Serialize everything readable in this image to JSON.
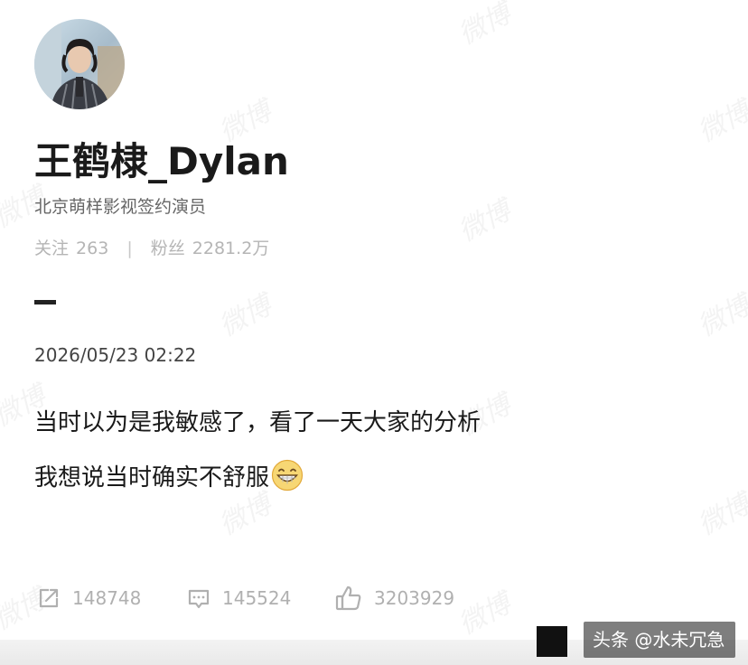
{
  "profile": {
    "name": "王鹤棣_Dylan",
    "verification": "北京萌样影视签约演员",
    "following_label": "关注",
    "following_count": "263",
    "separator": "|",
    "followers_label": "粉丝",
    "followers_count": "2281.2万",
    "avatar_icon": "avatar-photo"
  },
  "post": {
    "dash": "—",
    "timestamp": "2026/05/23 02:22",
    "line1": "当时以为是我敏感了，看了一天大家的分析",
    "line2": "我想说当时确实不舒服",
    "emoji": "grinning-face-emoji"
  },
  "actions": {
    "repost_icon": "share-icon",
    "repost_count": "148748",
    "comment_icon": "comment-icon",
    "comment_count": "145524",
    "like_icon": "thumbs-up-icon",
    "like_count": "3203929"
  },
  "watermark": "微博",
  "source_tag": "头条 @水未冗急",
  "colors": {
    "text_primary": "#1a1a1a",
    "text_secondary": "#666666",
    "text_muted": "#b5b5b5",
    "background": "#ffffff"
  }
}
